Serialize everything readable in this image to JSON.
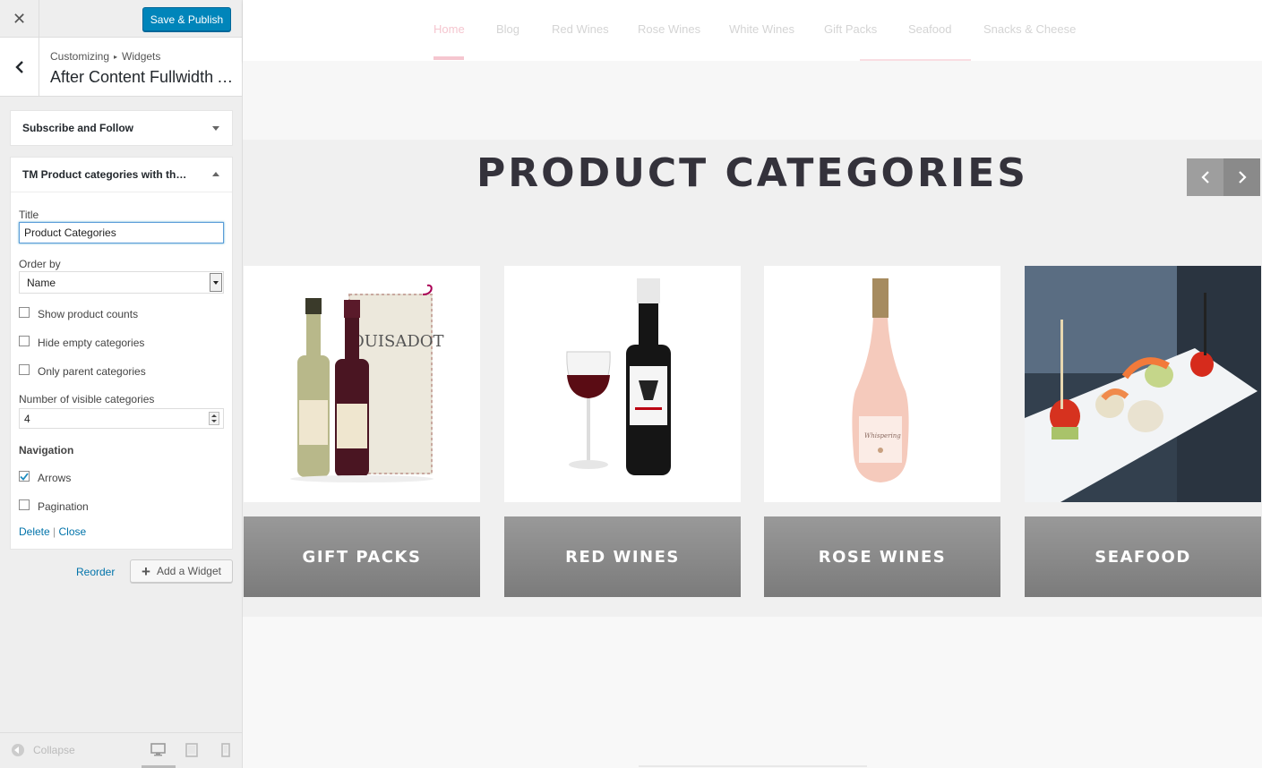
{
  "customizer": {
    "close_icon": "close-icon",
    "publish_label": "Save & Publish",
    "breadcrumb": {
      "root": "Customizing",
      "section": "Widgets"
    },
    "panel_title": "After Content Fullwidth Area",
    "widgets": [
      {
        "title": "Subscribe and Follow",
        "expanded": false
      },
      {
        "title": "TM Product categories with thumbnails",
        "expanded": true
      }
    ],
    "form": {
      "title_label": "Title",
      "title_value": "Product Categories",
      "orderby_label": "Order by",
      "orderby_value": "Name",
      "checkboxes": [
        {
          "label": "Show product counts",
          "checked": false
        },
        {
          "label": "Hide empty categories",
          "checked": false
        },
        {
          "label": "Only parent categories",
          "checked": false
        }
      ],
      "visible_label": "Number of visible categories",
      "visible_value": "4",
      "navigation_heading": "Navigation",
      "nav_options": [
        {
          "label": "Arrows",
          "checked": true
        },
        {
          "label": "Pagination",
          "checked": false
        }
      ],
      "delete_label": "Delete",
      "close_label": "Close"
    },
    "reorder_label": "Reorder",
    "add_widget_label": "Add a Widget",
    "collapse_label": "Collapse",
    "accent": "#0085ba"
  },
  "preview": {
    "nav": [
      {
        "label": "Home",
        "active": true
      },
      {
        "label": "Blog",
        "active": false
      },
      {
        "label": "Red Wines",
        "active": false
      },
      {
        "label": "Rose Wines",
        "active": false
      },
      {
        "label": "White Wines",
        "active": false
      },
      {
        "label": "Gift Packs",
        "active": false
      },
      {
        "label": "Seafood",
        "active": false
      },
      {
        "label": "Snacks & Cheese",
        "active": false
      }
    ],
    "section_title": "PRODUCT CATEGORIES",
    "categories": [
      {
        "label": "GIFT PACKS",
        "image": "wine-gift-box"
      },
      {
        "label": "RED WINES",
        "image": "red-wine-bottle-and-glass"
      },
      {
        "label": "ROSE WINES",
        "image": "rose-wine-bottle"
      },
      {
        "label": "SEAFOOD",
        "image": "seafood-canapes-platter"
      }
    ],
    "nav_accent": "#f5c6cf",
    "title_color": "#34323b"
  }
}
